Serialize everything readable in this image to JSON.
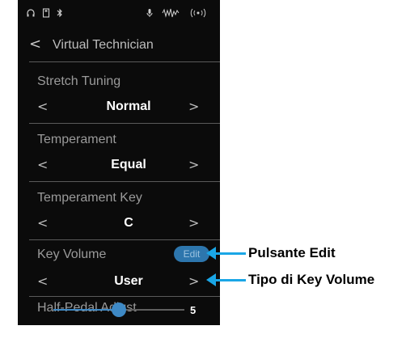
{
  "colors": {
    "accent": "#3e89c5",
    "callout_line": "#1aa6e6",
    "background": "#0b0b0b"
  },
  "statusbar": {
    "icons": [
      "headphone-icon",
      "usb-icon",
      "bluetooth-icon",
      "microphone-icon",
      "audio-recorder-icon",
      "wireless-icon"
    ]
  },
  "header": {
    "back": "<",
    "title": "Virtual Technician"
  },
  "settings": [
    {
      "label": "Stretch Tuning",
      "value": "Normal"
    },
    {
      "label": "Temperament",
      "value": "Equal"
    },
    {
      "label": "Temperament Key",
      "value": "C"
    },
    {
      "label": "Key Volume",
      "value": "User",
      "edit_label": "Edit"
    }
  ],
  "arrows": {
    "left": "<",
    "right": ">"
  },
  "half_pedal": {
    "label": "Half-Pedal Adjust",
    "value": "5",
    "level": 0.5
  },
  "callouts": {
    "edit_button": "Pulsante Edit",
    "key_volume_type": "Tipo di Key Volume"
  }
}
